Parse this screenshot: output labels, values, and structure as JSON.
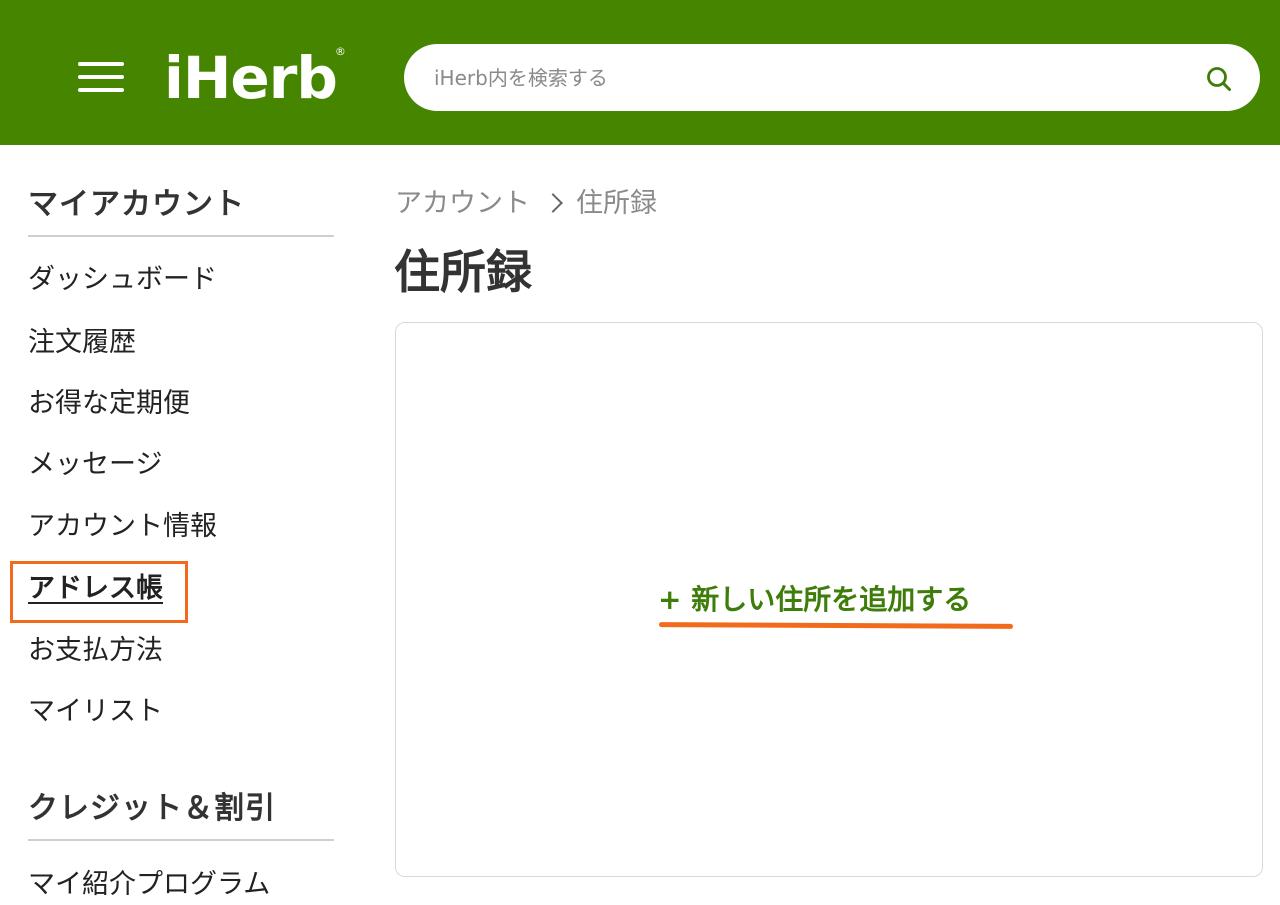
{
  "header": {
    "logo_text": "iHerb",
    "logo_reg": "®",
    "search_placeholder": "iHerb内を検索する"
  },
  "sidebar": {
    "sections": [
      {
        "heading": "マイアカウント",
        "items": [
          {
            "label": "ダッシュボード"
          },
          {
            "label": "注文履歴"
          },
          {
            "label": "お得な定期便"
          },
          {
            "label": "メッセージ"
          },
          {
            "label": "アカウント情報"
          },
          {
            "label": "アドレス帳",
            "active": true
          },
          {
            "label": "お支払方法"
          },
          {
            "label": "マイリスト"
          }
        ]
      },
      {
        "heading": "クレジット＆割引",
        "items": [
          {
            "label": "マイ紹介プログラム"
          }
        ]
      }
    ]
  },
  "main": {
    "breadcrumb": [
      "アカウント",
      "住所録"
    ],
    "title": "住所録",
    "add_address_label": "+ 新しい住所を追加する"
  },
  "colors": {
    "brand_green": "#458500",
    "link_green": "#3f7d0a",
    "highlight_orange": "#f26b1d"
  },
  "icons": {
    "menu": "hamburger-menu-icon",
    "search": "search-icon",
    "breadcrumb_separator": "chevron-right-icon"
  }
}
